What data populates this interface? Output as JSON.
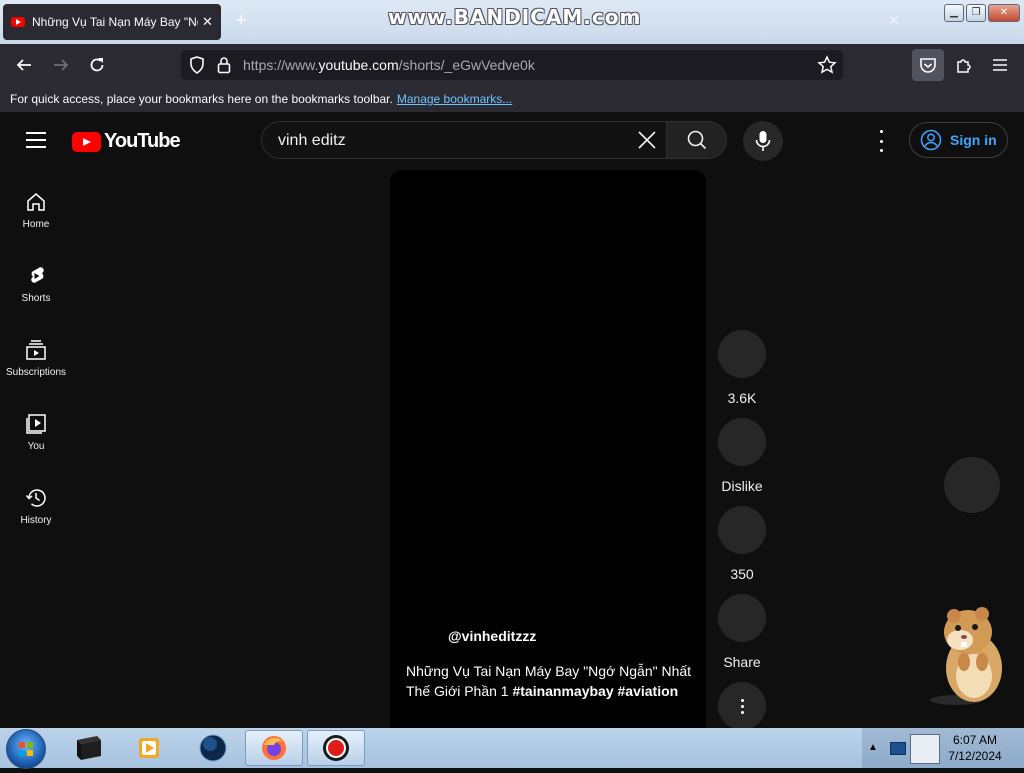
{
  "browser": {
    "tab_title": "Những Vụ Tai Nạn Máy Bay \"Ng",
    "tab_close": "✕",
    "new_tab": "+",
    "watermark": "www.BANDICAM.com",
    "url_prefix": "https://www.",
    "url_host": "youtube.com",
    "url_path": "/shorts/_eGwVedve0k",
    "bookmarks_text": "For quick access, place your bookmarks here on the bookmarks toolbar.",
    "bookmarks_link": "Manage bookmarks..."
  },
  "youtube": {
    "logo_text": "YouTube",
    "search_value": "vinh editz",
    "sign_in": "Sign in",
    "sidebar": [
      {
        "label": "Home"
      },
      {
        "label": "Shorts"
      },
      {
        "label": "Subscriptions"
      },
      {
        "label": "You"
      },
      {
        "label": "History"
      }
    ],
    "short": {
      "channel": "@vinheditzzz",
      "caption_text": "Những Vụ Tai Nạn Máy Bay \"Ngớ Ngẫn\" Nhất Thế Giới Phần 1 ",
      "hashtags": "#tainanmaybay #aviation"
    },
    "actions": {
      "likes": "3.6K",
      "dislike": "Dislike",
      "comments": "350",
      "share": "Share"
    }
  },
  "taskbar": {
    "time": "6:07 AM",
    "date": "7/12/2024"
  },
  "colors": {
    "yt_red": "#ff0000",
    "link_blue": "#3ea6ff",
    "page_bg": "#0f0f0f"
  }
}
